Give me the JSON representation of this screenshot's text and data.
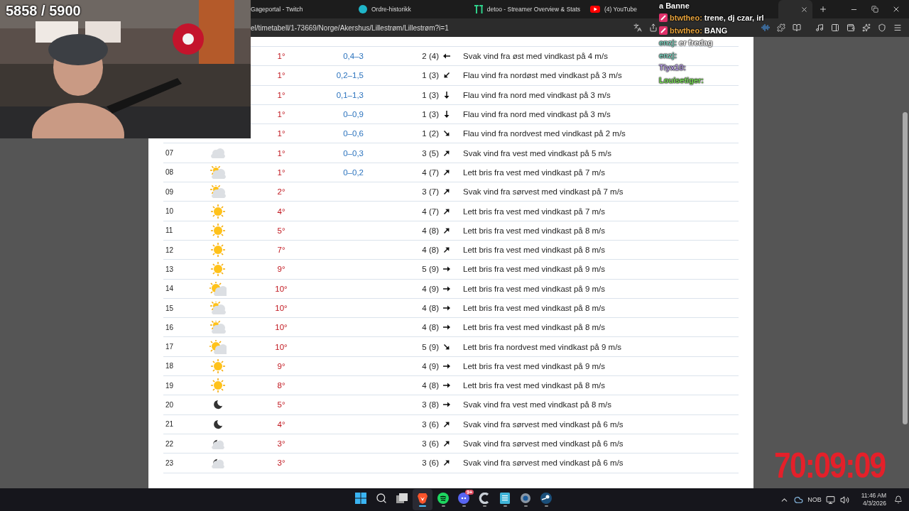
{
  "stream_overlay": {
    "counter": "5858 / 5900",
    "timer": "70:09:09"
  },
  "chat": [
    {
      "color": "#ffffff",
      "message": "a Banne",
      "badge": false
    },
    {
      "user": "btwtheo:",
      "color": "#e8a33c",
      "message": "trene, dj czar, irl",
      "badge": true
    },
    {
      "user": "btwtheo:",
      "color": "#e8a33c",
      "message": "BANG",
      "badge": true
    },
    {
      "user": "enzj:",
      "color": "#7dd3c0",
      "message": "er fredag",
      "badge": false
    },
    {
      "user": "enzj:",
      "color": "#7dd3c0",
      "badge": false
    },
    {
      "user": "Tlyx10:",
      "color": "#b9a0e6",
      "badge": false
    },
    {
      "user": "Louisetiger:",
      "color": "#7ce05a",
      "badge": false
    }
  ],
  "browser": {
    "tabs": [
      {
        "title": "Gageportal - Twitch",
        "favicon": {
          "kind": "none"
        },
        "selected": false
      },
      {
        "title": "Ordre-historikk",
        "favicon": {
          "kind": "circle"
        },
        "selected": false
      },
      {
        "title": "detoo - Streamer Overview & Stats",
        "favicon": {
          "kind": "tt"
        },
        "selected": false
      },
      {
        "title": "(4) YouTube",
        "favicon": {
          "kind": "youtube"
        },
        "selected": false
      },
      {
        "favicon": {
          "kind": "none"
        },
        "selected": true
      }
    ],
    "address": "el/timetabell/1-73669/Norge/Akershus/Lillestrøm/Lillestrøm?i=1"
  },
  "forecast": {
    "rows": [
      {
        "temperature": "1°",
        "precipitation": "0,4–3",
        "wind": "2 (4)",
        "arrow": {
          "kind": "w"
        },
        "description": "Svak vind fra øst med vindkast på 4 m/s"
      },
      {
        "temperature": "1°",
        "precipitation": "0,2–1,5",
        "wind": "1 (3)",
        "arrow": {
          "kind": "sw"
        },
        "description": "Flau vind fra nordøst med vindkast på 3 m/s"
      },
      {
        "temperature": "1°",
        "precipitation": "0,1–1,3",
        "wind": "1 (3)",
        "arrow": {
          "kind": "s"
        },
        "description": "Flau vind fra nord med vindkast på 3 m/s"
      },
      {
        "temperature": "1°",
        "precipitation": "0–0,9",
        "wind": "1 (3)",
        "arrow": {
          "kind": "s"
        },
        "description": "Flau vind fra nord med vindkast på 3 m/s"
      },
      {
        "temperature": "1°",
        "precipitation": "0–0,6",
        "wind": "1 (2)",
        "arrow": {
          "kind": "se"
        },
        "description": "Flau vind fra nordvest med vindkast på 2 m/s"
      },
      {
        "hour": "07",
        "weather": {
          "kind": "cloud"
        },
        "temperature": "1°",
        "precipitation": "0–0,3",
        "wind": "3 (5)",
        "arrow": {
          "kind": "ne"
        },
        "description": "Svak vind fra vest med vindkast på 5 m/s"
      },
      {
        "hour": "08",
        "weather": {
          "kind": "partly-cloudy"
        },
        "temperature": "1°",
        "precipitation": "0–0,2",
        "wind": "4 (7)",
        "arrow": {
          "kind": "ne"
        },
        "description": "Lett bris fra vest med vindkast på 7 m/s"
      },
      {
        "hour": "09",
        "weather": {
          "kind": "partly-cloudy"
        },
        "temperature": "2°",
        "wind": "3 (7)",
        "arrow": {
          "kind": "ne"
        },
        "description": "Svak vind fra sørvest med vindkast på 7 m/s"
      },
      {
        "hour": "10",
        "weather": {
          "kind": "sun"
        },
        "temperature": "4°",
        "wind": "4 (7)",
        "arrow": {
          "kind": "ne"
        },
        "description": "Lett bris fra vest med vindkast på 7 m/s"
      },
      {
        "hour": "11",
        "weather": {
          "kind": "sun"
        },
        "temperature": "5°",
        "wind": "4 (8)",
        "arrow": {
          "kind": "ne"
        },
        "description": "Lett bris fra vest med vindkast på 8 m/s"
      },
      {
        "hour": "12",
        "weather": {
          "kind": "sun"
        },
        "temperature": "7°",
        "wind": "4 (8)",
        "arrow": {
          "kind": "ne"
        },
        "description": "Lett bris fra vest med vindkast på 8 m/s"
      },
      {
        "hour": "13",
        "weather": {
          "kind": "sun"
        },
        "temperature": "9°",
        "wind": "5 (9)",
        "arrow": {
          "kind": "e"
        },
        "description": "Lett bris fra vest med vindkast på 9 m/s"
      },
      {
        "hour": "14",
        "weather": {
          "kind": "partly-sunny"
        },
        "temperature": "10°",
        "wind": "4 (9)",
        "arrow": {
          "kind": "e"
        },
        "description": "Lett bris fra vest med vindkast på 9 m/s"
      },
      {
        "hour": "15",
        "weather": {
          "kind": "partly-cloudy"
        },
        "temperature": "10°",
        "wind": "4 (8)",
        "arrow": {
          "kind": "e"
        },
        "description": "Lett bris fra vest med vindkast på 8 m/s"
      },
      {
        "hour": "16",
        "weather": {
          "kind": "partly-cloudy"
        },
        "temperature": "10°",
        "wind": "4 (8)",
        "arrow": {
          "kind": "e"
        },
        "description": "Lett bris fra vest med vindkast på 8 m/s"
      },
      {
        "hour": "17",
        "weather": {
          "kind": "partly-sunny"
        },
        "temperature": "10°",
        "wind": "5 (9)",
        "arrow": {
          "kind": "se"
        },
        "description": "Lett bris fra nordvest med vindkast på 9 m/s"
      },
      {
        "hour": "18",
        "weather": {
          "kind": "sun"
        },
        "temperature": "9°",
        "wind": "4 (9)",
        "arrow": {
          "kind": "e"
        },
        "description": "Lett bris fra vest med vindkast på 9 m/s"
      },
      {
        "hour": "19",
        "weather": {
          "kind": "sun"
        },
        "temperature": "8°",
        "wind": "4 (8)",
        "arrow": {
          "kind": "e"
        },
        "description": "Lett bris fra vest med vindkast på 8 m/s"
      },
      {
        "hour": "20",
        "weather": {
          "kind": "moon"
        },
        "temperature": "5°",
        "wind": "3 (8)",
        "arrow": {
          "kind": "e"
        },
        "description": "Svak vind fra vest med vindkast på 8 m/s"
      },
      {
        "hour": "21",
        "weather": {
          "kind": "moon"
        },
        "temperature": "4°",
        "wind": "3 (6)",
        "arrow": {
          "kind": "ne"
        },
        "description": "Svak vind fra sørvest med vindkast på 6 m/s"
      },
      {
        "hour": "22",
        "weather": {
          "kind": "moon-cloud"
        },
        "temperature": "3°",
        "wind": "3 (6)",
        "arrow": {
          "kind": "ne"
        },
        "description": "Svak vind fra sørvest med vindkast på 6 m/s"
      },
      {
        "hour": "23",
        "weather": {
          "kind": "moon-cloud"
        },
        "temperature": "3°",
        "wind": "3 (6)",
        "arrow": {
          "kind": "ne"
        },
        "description": "Svak vind fra sørvest med vindkast på 6 m/s"
      }
    ]
  },
  "taskbar": {
    "apps": [
      {
        "kind": "windows",
        "running": false,
        "active": false
      },
      {
        "kind": "search",
        "running": false,
        "active": false
      },
      {
        "kind": "taskview",
        "running": false,
        "active": false
      },
      {
        "kind": "brave",
        "running": true,
        "active": true
      },
      {
        "kind": "spotify",
        "running": true,
        "active": false
      },
      {
        "kind": "discord",
        "running": true,
        "active": false,
        "badge": "9+"
      },
      {
        "kind": "ccleaner",
        "running": true,
        "active": false
      },
      {
        "kind": "notepad",
        "running": true,
        "active": false
      },
      {
        "kind": "settings",
        "running": true,
        "active": false
      },
      {
        "kind": "steam",
        "running": true,
        "active": false
      }
    ],
    "language": "NOB",
    "time": "11:46 AM",
    "date": "4/3/2026"
  }
}
